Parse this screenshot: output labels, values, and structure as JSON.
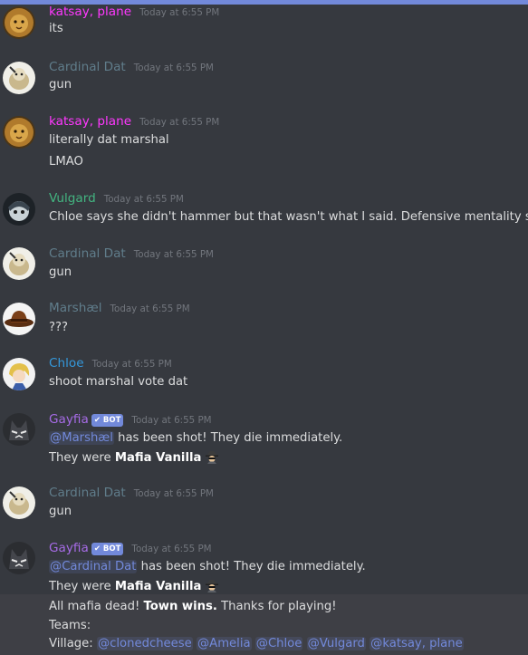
{
  "colors": {
    "background": "#36393f",
    "text": "#dcddde",
    "timestamp": "#72767d",
    "katsay": "#ff38ff",
    "cardinal": "#607d8b",
    "vulgard": "#43b581",
    "marshael": "#607d8b",
    "chloe": "#3498db",
    "gayfia": "#a66be6",
    "mention": "#7289da"
  },
  "bot_badge": "✔ BOT",
  "messages": [
    {
      "author": "katsay, plane",
      "time": "Today at 6:55 PM",
      "lines": [
        "its"
      ]
    },
    {
      "author": "Cardinal Dat",
      "time": "Today at 6:55 PM",
      "lines": [
        "gun"
      ]
    },
    {
      "author": "katsay, plane",
      "time": "Today at 6:55 PM",
      "lines": [
        "literally dat marshal",
        "LMAO"
      ]
    },
    {
      "author": "Vulgard",
      "time": "Today at 6:55 PM",
      "lines": [
        "Chloe says she didn't hammer but that wasn't what I said. Defensive mentality slip."
      ]
    },
    {
      "author": "Cardinal Dat",
      "time": "Today at 6:55 PM",
      "lines": [
        "gun"
      ]
    },
    {
      "author": "Marshæl",
      "time": "Today at 6:55 PM",
      "lines": [
        "???"
      ]
    },
    {
      "author": "Chloe",
      "time": "Today at 6:55 PM",
      "lines": [
        "shoot marshal vote dat"
      ]
    },
    {
      "author": "Gayfia",
      "time": "Today at 6:55 PM",
      "mention": "@Marshæl",
      "shot_text": " has been shot! They die immediately.",
      "were_text": "They were ",
      "role": "Mafia Vanilla"
    },
    {
      "author": "Cardinal Dat",
      "time": "Today at 6:55 PM",
      "lines": [
        "gun"
      ]
    },
    {
      "author": "Gayfia",
      "time": "Today at 6:55 PM",
      "mention": "@Cardinal Dat",
      "shot_text": " has been shot! They die immediately.",
      "were_text": "They were ",
      "role": "Mafia Vanilla",
      "end_pre": "All mafia dead! ",
      "end_bold": "Town wins.",
      "end_post": " Thanks for playing!",
      "teams_label": "Teams:",
      "village_label": "Village: ",
      "village": [
        "@clonedcheese",
        "@Amelia",
        "@Chloe",
        "@Vulgard",
        "@katsay, plane"
      ]
    }
  ]
}
